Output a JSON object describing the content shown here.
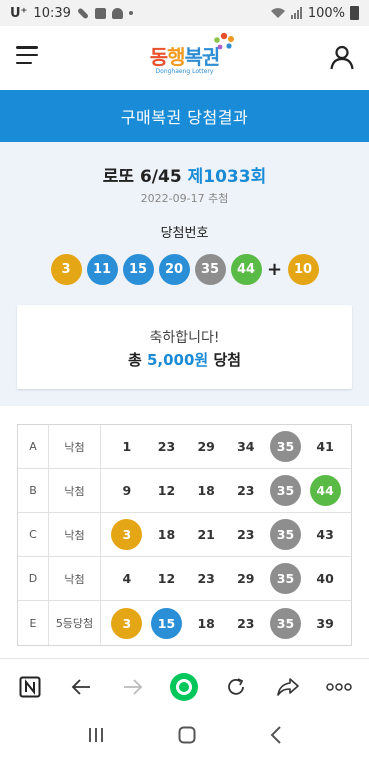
{
  "status_bar": {
    "carrier": "U⁺",
    "time": "10:39",
    "battery": "100%"
  },
  "header": {
    "logo_part1": "동",
    "logo_part2": "행",
    "logo_part3": "복권",
    "logo_sub": "Donghaeng Lottery"
  },
  "page_title": "구매복권 당첨결과",
  "result": {
    "game_name": "로또 6/45",
    "round": "제1033회",
    "draw_date": "2022-09-17 추첨",
    "winning_label": "당첨번호",
    "winning_numbers": [
      {
        "value": "3",
        "color": "#e5a616"
      },
      {
        "value": "11",
        "color": "#2a8fd6"
      },
      {
        "value": "15",
        "color": "#2a8fd6"
      },
      {
        "value": "20",
        "color": "#2a8fd6"
      },
      {
        "value": "35",
        "color": "#8e8e8e"
      },
      {
        "value": "44",
        "color": "#5aba46"
      }
    ],
    "plus": "+",
    "bonus": {
      "value": "10",
      "color": "#e5a616"
    },
    "congrats": "축하합니다!",
    "prize_prefix": "총 ",
    "prize_amount": "5,000원",
    "prize_suffix": " 당첨"
  },
  "ticket_rows": [
    {
      "letter": "A",
      "status": "낙첨",
      "numbers": [
        {
          "v": "1",
          "c": ""
        },
        {
          "v": "23",
          "c": ""
        },
        {
          "v": "29",
          "c": ""
        },
        {
          "v": "34",
          "c": ""
        },
        {
          "v": "35",
          "c": "#8e8e8e"
        },
        {
          "v": "41",
          "c": ""
        }
      ]
    },
    {
      "letter": "B",
      "status": "낙첨",
      "numbers": [
        {
          "v": "9",
          "c": ""
        },
        {
          "v": "12",
          "c": ""
        },
        {
          "v": "18",
          "c": ""
        },
        {
          "v": "23",
          "c": ""
        },
        {
          "v": "35",
          "c": "#8e8e8e"
        },
        {
          "v": "44",
          "c": "#5aba46"
        }
      ]
    },
    {
      "letter": "C",
      "status": "낙첨",
      "numbers": [
        {
          "v": "3",
          "c": "#e5a616"
        },
        {
          "v": "18",
          "c": ""
        },
        {
          "v": "21",
          "c": ""
        },
        {
          "v": "23",
          "c": ""
        },
        {
          "v": "35",
          "c": "#8e8e8e"
        },
        {
          "v": "43",
          "c": ""
        }
      ]
    },
    {
      "letter": "D",
      "status": "낙첨",
      "numbers": [
        {
          "v": "4",
          "c": ""
        },
        {
          "v": "12",
          "c": ""
        },
        {
          "v": "23",
          "c": ""
        },
        {
          "v": "29",
          "c": ""
        },
        {
          "v": "35",
          "c": "#8e8e8e"
        },
        {
          "v": "40",
          "c": ""
        }
      ]
    },
    {
      "letter": "E",
      "status": "5등당첨",
      "numbers": [
        {
          "v": "3",
          "c": "#e5a616"
        },
        {
          "v": "15",
          "c": "#2a8fd6"
        },
        {
          "v": "18",
          "c": ""
        },
        {
          "v": "23",
          "c": ""
        },
        {
          "v": "35",
          "c": "#8e8e8e"
        },
        {
          "v": "39",
          "c": ""
        }
      ]
    }
  ],
  "browser_toolbar": {
    "icons": [
      "naver-n-icon",
      "back-arrow-icon",
      "forward-arrow-icon",
      "home-circle-icon",
      "reload-icon",
      "share-icon",
      "more-icon"
    ],
    "accent": "#03c75a"
  },
  "nav_bar": {
    "icons": [
      "recent-apps-icon",
      "home-icon",
      "back-icon"
    ]
  }
}
